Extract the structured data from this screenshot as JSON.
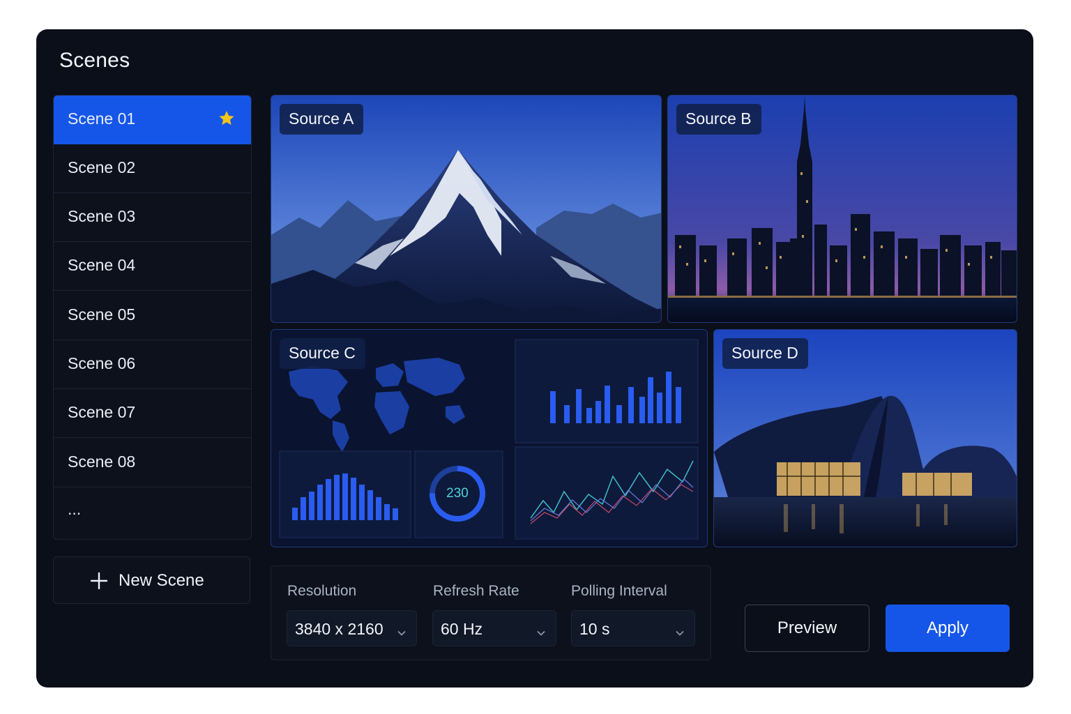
{
  "panel": {
    "title": "Scenes"
  },
  "scenes": {
    "items": [
      {
        "label": "Scene 01",
        "active": true,
        "starred": true
      },
      {
        "label": "Scene 02"
      },
      {
        "label": "Scene 03"
      },
      {
        "label": "Scene 04"
      },
      {
        "label": "Scene 05"
      },
      {
        "label": "Scene 06"
      },
      {
        "label": "Scene 07"
      },
      {
        "label": "Scene 08"
      },
      {
        "label": "..."
      }
    ],
    "new_scene_label": "New Scene"
  },
  "sources": {
    "a": {
      "label": "Source A",
      "content": "mountain-image"
    },
    "b": {
      "label": "Source B",
      "content": "city-skyline-image"
    },
    "c": {
      "label": "Source C",
      "content": "dashboard-image",
      "gauge_value": "230"
    },
    "d": {
      "label": "Source D",
      "content": "building-image"
    }
  },
  "settings": {
    "resolution": {
      "label": "Resolution",
      "value": "3840 x 2160"
    },
    "refresh_rate": {
      "label": "Refresh Rate",
      "value": "60 Hz"
    },
    "polling_interval": {
      "label": "Polling Interval",
      "value": "10 s"
    }
  },
  "actions": {
    "preview_label": "Preview",
    "apply_label": "Apply"
  },
  "colors": {
    "accent": "#1556e8",
    "panel_bg": "#0a0f1a",
    "star": "#f5c518"
  }
}
